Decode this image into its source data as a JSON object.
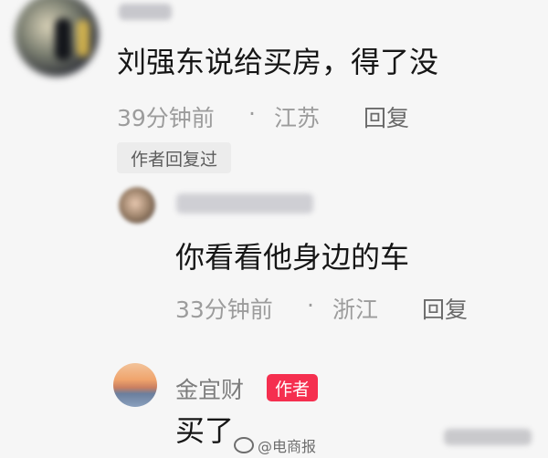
{
  "comment_1": {
    "text": "刘强东说给买房，得了没",
    "time": "39分钟前",
    "separator": "·",
    "location": "江苏",
    "reply_label": "回复",
    "author_replied_tag": "作者回复过"
  },
  "reply_1": {
    "text": "你看看他身边的车",
    "time": "33分钟前",
    "separator": "·",
    "location": "浙江",
    "reply_label": "回复"
  },
  "reply_2": {
    "author_name": "金宜财",
    "badge": "作者",
    "text": "买了"
  },
  "watermark": {
    "text": "@电商报"
  },
  "colors": {
    "background": "#f6f6f6",
    "author_badge": "#f52f4f",
    "meta_text": "#9c9c9c"
  }
}
